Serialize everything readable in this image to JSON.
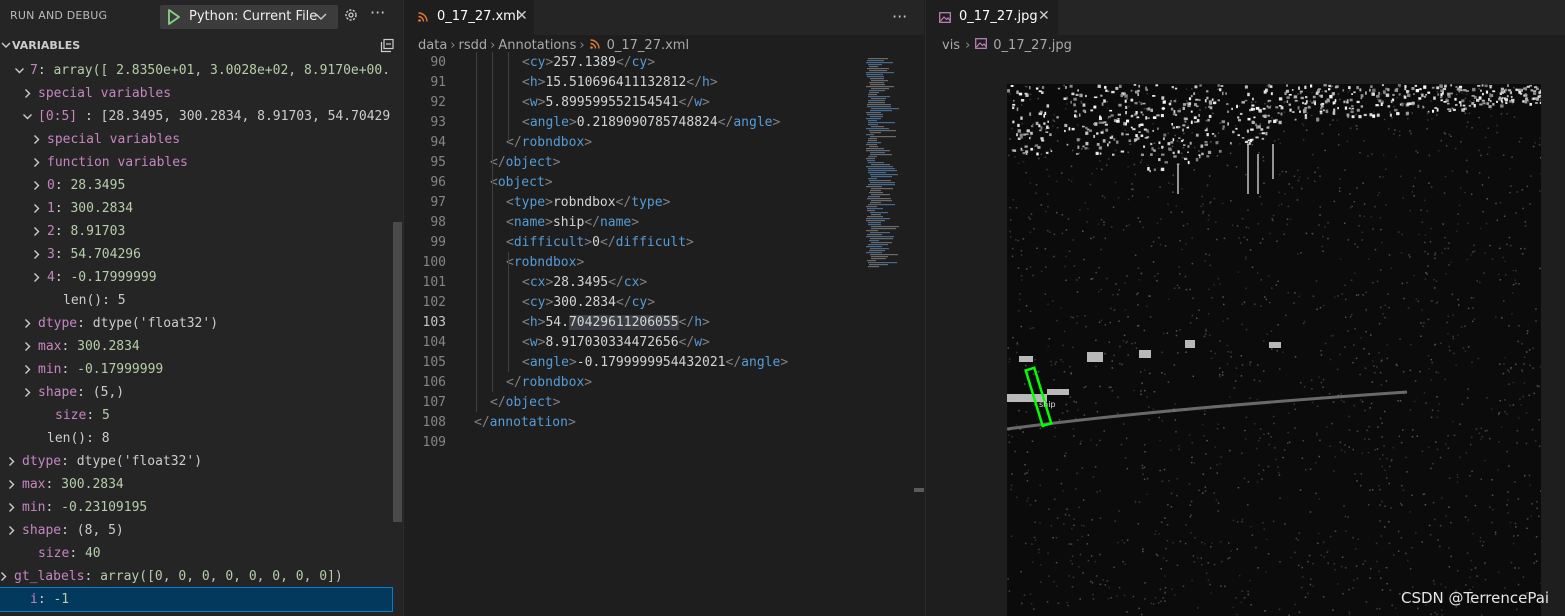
{
  "sidebar": {
    "title": "RUN AND DEBUG",
    "config_label": "Python: Current File",
    "variables_title": "VARIABLES",
    "rows": [
      {
        "name": "7",
        "value": "array([ 2.8350e+01,  3.0028e+02,  8.9170e+00..."
      },
      {
        "name": "special variables",
        "value": ""
      },
      {
        "name": "[0:5]",
        "value": "[28.3495, 300.2834, 8.91703, 54.70429..."
      },
      {
        "name": "special variables",
        "value": ""
      },
      {
        "name": "function variables",
        "value": ""
      },
      {
        "name": "0",
        "value": "28.3495"
      },
      {
        "name": "1",
        "value": "300.2834"
      },
      {
        "name": "2",
        "value": "8.91703"
      },
      {
        "name": "3",
        "value": "54.704296"
      },
      {
        "name": "4",
        "value": "-0.17999999"
      },
      {
        "name": "",
        "value": "len(): 5"
      },
      {
        "name": "dtype",
        "value": "dtype('float32')"
      },
      {
        "name": "max",
        "value": "300.2834"
      },
      {
        "name": "min",
        "value": "-0.17999999"
      },
      {
        "name": "shape",
        "value": "(5,)"
      },
      {
        "name": "size",
        "value": "5"
      },
      {
        "name": "",
        "value": "len(): 8"
      },
      {
        "name": "dtype",
        "value": "dtype('float32')"
      },
      {
        "name": "max",
        "value": "300.2834"
      },
      {
        "name": "min",
        "value": "-0.23109195"
      },
      {
        "name": "shape",
        "value": "(8, 5)"
      },
      {
        "name": "size",
        "value": "40"
      },
      {
        "name": "gt_labels",
        "value": "array([0, 0, 0, 0, 0, 0, 0, 0])"
      },
      {
        "name": "i",
        "value": "-1"
      }
    ]
  },
  "editor": {
    "tab_label": "0_17_27.xml",
    "breadcrumb": [
      "data",
      "rsdd",
      "Annotations",
      "0_17_27.xml"
    ],
    "lines": [
      {
        "n": "90",
        "open": "cy",
        "text": "257.1389",
        "close": "cy"
      },
      {
        "n": "91",
        "open": "h",
        "text": "15.510696411132812",
        "close": "h"
      },
      {
        "n": "92",
        "open": "w",
        "text": "5.899599552154541",
        "close": "w"
      },
      {
        "n": "93",
        "open": "angle",
        "text": "0.2189090785748824",
        "close": "angle"
      },
      {
        "n": "94",
        "open": "",
        "text": "",
        "close": "robndbox"
      },
      {
        "n": "95",
        "open": "",
        "text": "",
        "close": "object"
      },
      {
        "n": "96",
        "open": "object",
        "text": "",
        "close": ""
      },
      {
        "n": "97",
        "open": "type",
        "text": "robndbox",
        "close": "type"
      },
      {
        "n": "98",
        "open": "name",
        "text": "ship",
        "close": "name"
      },
      {
        "n": "99",
        "open": "difficult",
        "text": "0",
        "close": "difficult"
      },
      {
        "n": "100",
        "open": "robndbox",
        "text": "",
        "close": ""
      },
      {
        "n": "101",
        "open": "cx",
        "text": "28.3495",
        "close": "cx"
      },
      {
        "n": "102",
        "open": "cy",
        "text": "300.2834",
        "close": "cy"
      },
      {
        "n": "103",
        "open": "h",
        "text": "54.",
        "hl": "70429611206055",
        "close": "h"
      },
      {
        "n": "104",
        "open": "w",
        "text": "8.917030334472656",
        "close": "w"
      },
      {
        "n": "105",
        "open": "angle",
        "text": "-0.1799999954432021",
        "close": "angle"
      },
      {
        "n": "106",
        "open": "",
        "text": "",
        "close": "robndbox"
      },
      {
        "n": "107",
        "open": "",
        "text": "",
        "close": "object"
      },
      {
        "n": "108",
        "open": "",
        "text": "",
        "close": "annotation"
      },
      {
        "n": "109",
        "open": "",
        "text": "",
        "close": ""
      }
    ]
  },
  "preview": {
    "tab_label": "0_17_27.jpg",
    "breadcrumb": [
      "vis",
      "0_17_27.jpg"
    ],
    "box_label": "ship",
    "watermark": "CSDN @TerrencePai"
  },
  "colors": {
    "accent": "#007fd4",
    "play": "#89d185",
    "box": "#00ff00",
    "xml_icon": "#e37933",
    "img_icon": "#c586c0"
  }
}
